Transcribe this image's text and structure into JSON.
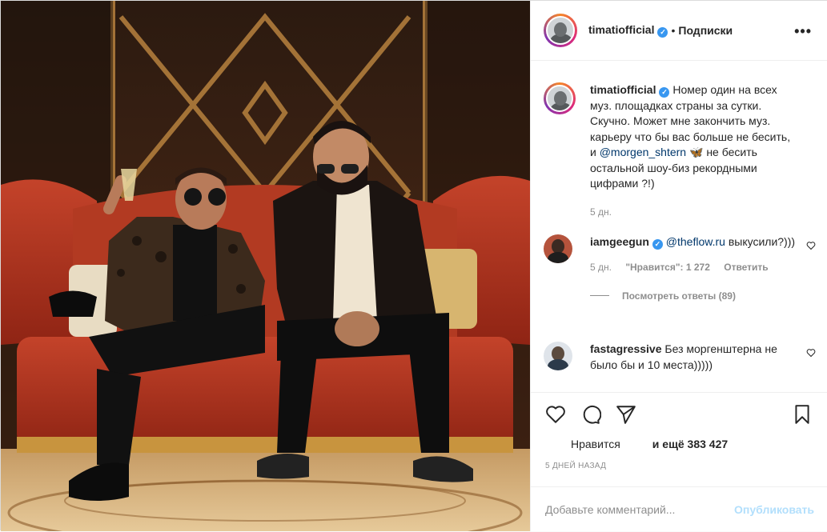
{
  "post": {
    "author": "timatiofficial",
    "follow_label": "Подписки",
    "more_label": "•••",
    "verified_mark": "✓"
  },
  "caption": {
    "username": "timatiofficial",
    "text_before": "Номер один на всех муз. площадках страны за сутки. Скучно. Может мне закончить муз. карьеру что бы вас больше не бесить, и ",
    "mention": "@morgen_shtern",
    "emoji": "🦋",
    "text_after": " не бесить остальной шоу-биз рекордными цифрами ?!)",
    "time": "5 дн."
  },
  "comments": [
    {
      "username": "iamgeegun",
      "mention": "@theflow.ru",
      "text": " выкусили?)))",
      "time": "5 дн.",
      "likes_label": "\"Нравится\": 1 272",
      "reply_label": "Ответить",
      "view_replies": "Посмотреть ответы (89)"
    },
    {
      "username": "fastagressive",
      "text": " Без моргенштерна не было бы и 10 места)))))"
    }
  ],
  "actions": {
    "like_icon": "heart-icon",
    "comment_icon": "comment-icon",
    "share_icon": "share-icon",
    "save_icon": "bookmark-icon",
    "liked_by": "Нравится",
    "and_more": "и ещё 383 427",
    "date": "5 ДНЕЙ НАЗАД"
  },
  "add_comment": {
    "placeholder": "Добавьте комментарий...",
    "post_label": "Опубликовать"
  },
  "colors": {
    "accent": "#3897f0",
    "post_button_disabled": "#b2dffc",
    "mention": "#00376b",
    "muted": "#8e8e8e"
  }
}
